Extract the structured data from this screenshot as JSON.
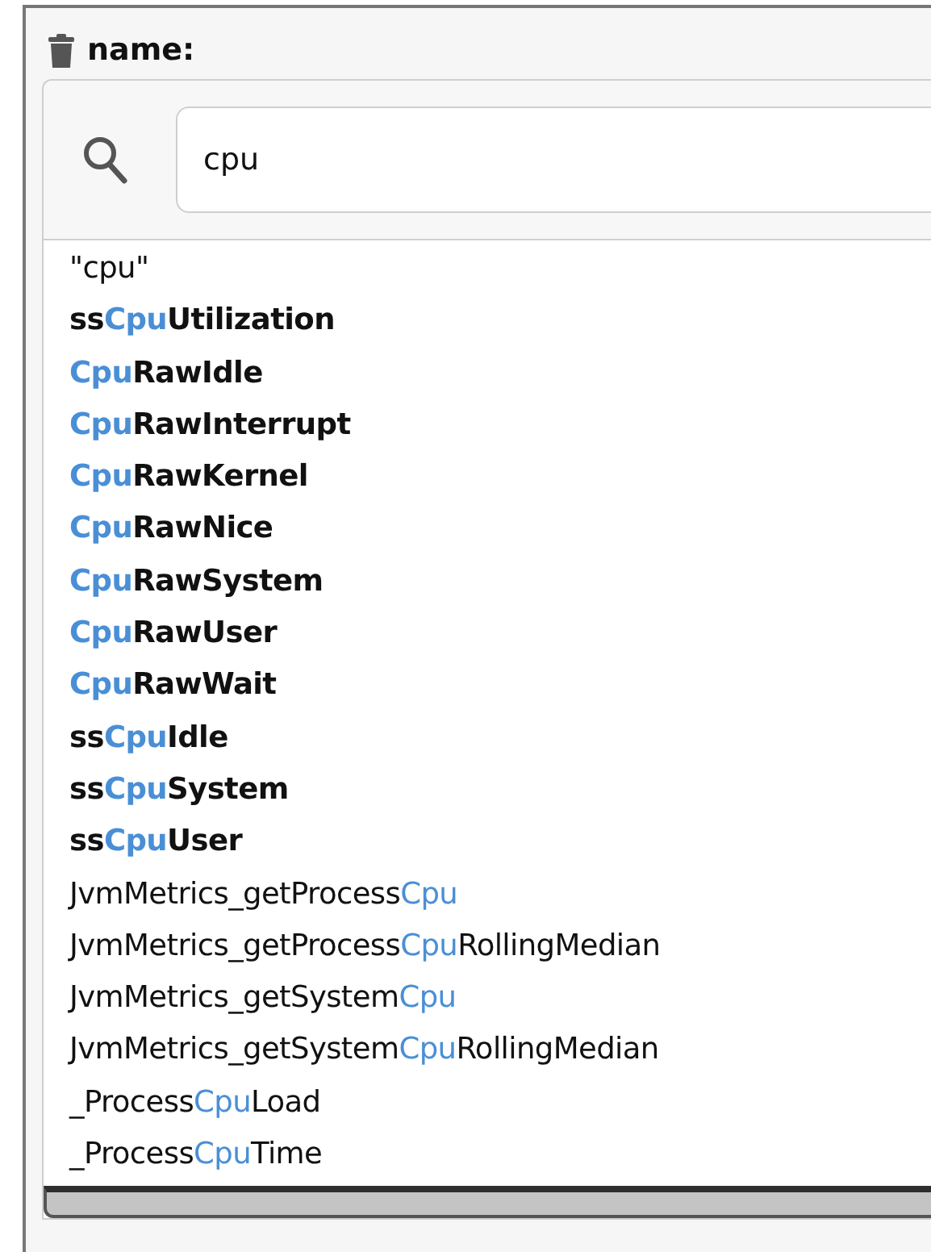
{
  "filter": {
    "label": "name:"
  },
  "search": {
    "value": "cpu"
  },
  "results": [
    {
      "before": "\"cpu\"",
      "bold": false
    },
    {
      "before": "ss",
      "match": "Cpu",
      "after": "Utilization",
      "bold": true
    },
    {
      "match": "Cpu",
      "after": "RawIdle",
      "bold": true
    },
    {
      "match": "Cpu",
      "after": "RawInterrupt",
      "bold": true
    },
    {
      "match": "Cpu",
      "after": "RawKernel",
      "bold": true
    },
    {
      "match": "Cpu",
      "after": "RawNice",
      "bold": true
    },
    {
      "match": "Cpu",
      "after": "RawSystem",
      "bold": true
    },
    {
      "match": "Cpu",
      "after": "RawUser",
      "bold": true
    },
    {
      "match": "Cpu",
      "after": "RawWait",
      "bold": true
    },
    {
      "before": "ss",
      "match": "Cpu",
      "after": "Idle",
      "bold": true
    },
    {
      "before": "ss",
      "match": "Cpu",
      "after": "System",
      "bold": true
    },
    {
      "before": "ss",
      "match": "Cpu",
      "after": "User",
      "bold": true
    },
    {
      "before": "JvmMetrics_getProcess",
      "match": "Cpu",
      "bold": false
    },
    {
      "before": "JvmMetrics_getProcess",
      "match": "Cpu",
      "after": "RollingMedian",
      "bold": false
    },
    {
      "before": "JvmMetrics_getSystem",
      "match": "Cpu",
      "bold": false
    },
    {
      "before": "JvmMetrics_getSystem",
      "match": "Cpu",
      "after": "RollingMedian",
      "bold": false
    },
    {
      "before": "_Process",
      "match": "Cpu",
      "after": "Load",
      "bold": false
    },
    {
      "before": "_Process",
      "match": "Cpu",
      "after": "Time",
      "bold": false
    }
  ]
}
